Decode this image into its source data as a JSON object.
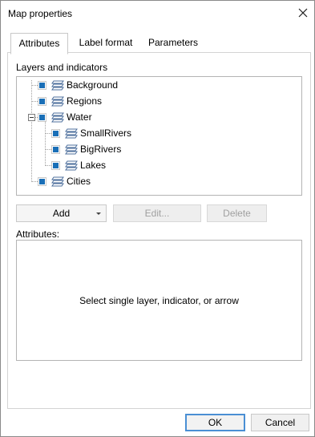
{
  "window": {
    "title": "Map properties",
    "close_icon": "close-icon"
  },
  "tabs": [
    {
      "label": "Attributes",
      "active": true
    },
    {
      "label": "Label format",
      "active": false
    },
    {
      "label": "Parameters",
      "active": false
    }
  ],
  "layers_section": {
    "label": "Layers and indicators",
    "items": [
      {
        "label": "Background",
        "checked": true,
        "icon": "layer-stack-icon"
      },
      {
        "label": "Regions",
        "checked": true,
        "icon": "layer-stack-icon"
      },
      {
        "label": "Water",
        "checked": true,
        "icon": "layer-stack-icon",
        "expanded": true
      },
      {
        "label": "SmallRivers",
        "checked": true,
        "icon": "layer-stack-icon"
      },
      {
        "label": "BigRivers",
        "checked": true,
        "icon": "layer-stack-icon"
      },
      {
        "label": "Lakes",
        "checked": true,
        "icon": "layer-stack-icon"
      },
      {
        "label": "Cities",
        "checked": true,
        "icon": "layer-stack-icon"
      }
    ]
  },
  "toolbar": {
    "add_label": "Add",
    "edit_label": "Edit...",
    "delete_label": "Delete"
  },
  "attributes": {
    "label": "Attributes:",
    "placeholder": "Select single layer, indicator, or arrow"
  },
  "footer": {
    "ok_label": "OK",
    "cancel_label": "Cancel"
  },
  "colors": {
    "checkbox_fill": "#1a6fb7",
    "ok_border": "#4a8fd4"
  }
}
